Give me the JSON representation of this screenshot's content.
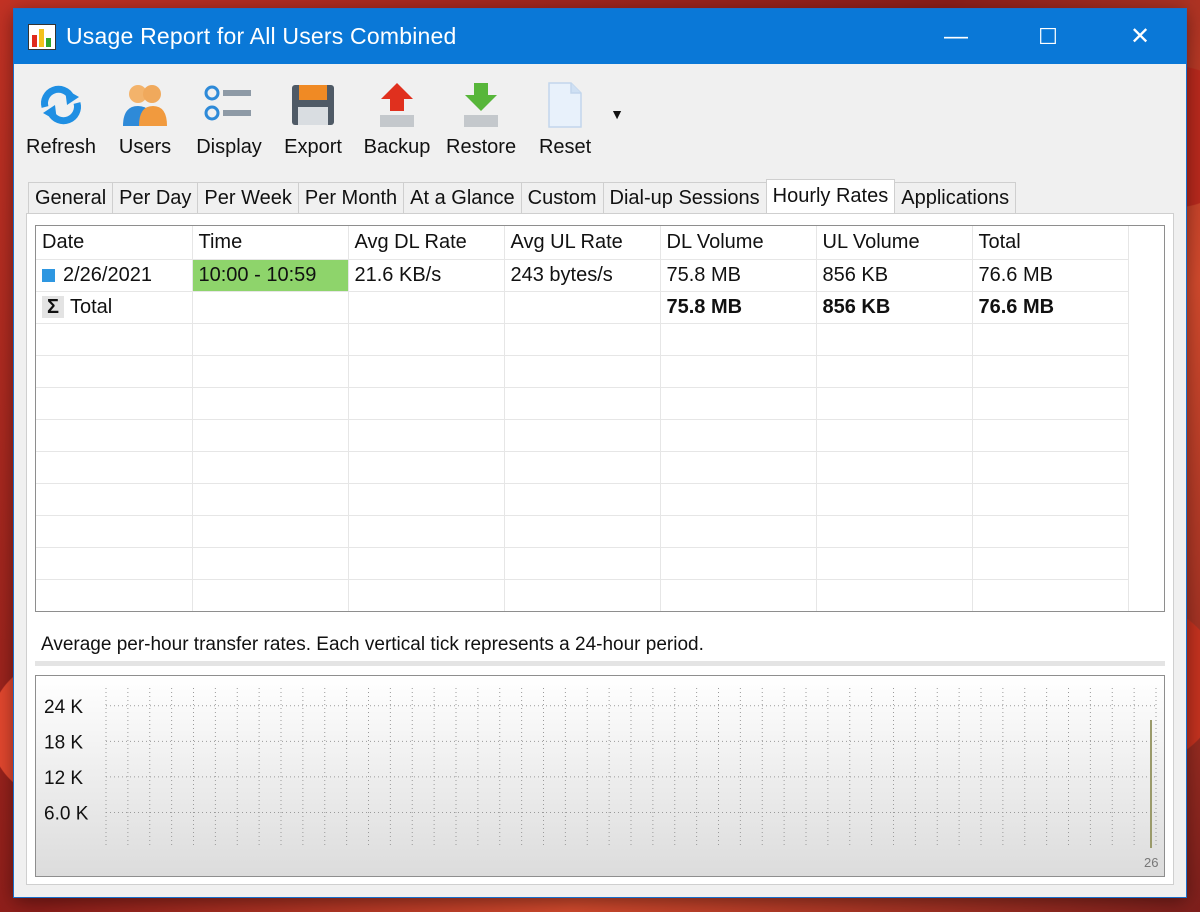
{
  "window": {
    "title": "Usage Report for All Users Combined",
    "controls": [
      "—",
      "☐",
      "✕"
    ]
  },
  "toolbar": [
    {
      "id": "refresh",
      "label": "Refresh",
      "icon": "refresh-icon"
    },
    {
      "id": "users",
      "label": "Users",
      "icon": "users-icon"
    },
    {
      "id": "display",
      "label": "Display",
      "icon": "display-list-icon"
    },
    {
      "id": "export",
      "label": "Export",
      "icon": "floppy-disk-icon"
    },
    {
      "id": "backup",
      "label": "Backup",
      "icon": "upload-arrow-icon"
    },
    {
      "id": "restore",
      "label": "Restore",
      "icon": "download-arrow-icon"
    },
    {
      "id": "reset",
      "label": "Reset",
      "icon": "blank-page-icon"
    }
  ],
  "tabs": [
    "General",
    "Per Day",
    "Per Week",
    "Per Month",
    "At a Glance",
    "Custom",
    "Dial-up Sessions",
    "Hourly Rates",
    "Applications"
  ],
  "active_tab": "Hourly Rates",
  "table": {
    "columns": [
      "Date",
      "Time",
      "Avg DL Rate",
      "Avg UL Rate",
      "DL Volume",
      "UL Volume",
      "Total"
    ],
    "rows": [
      {
        "date": "2/26/2021",
        "time": "10:00 - 10:59",
        "avg_dl": "21.6 KB/s",
        "avg_ul": "243 bytes/s",
        "dl_vol": "75.8 MB",
        "ul_vol": "856 KB",
        "total": "76.6 MB"
      }
    ],
    "total_row": {
      "label": "Total",
      "sigma": "Σ",
      "dl_vol": "75.8 MB",
      "ul_vol": "856 KB",
      "total": "76.6 MB"
    }
  },
  "caption": "Average per-hour transfer rates. Each vertical tick represents a 24-hour period.",
  "chart_data": {
    "type": "bar",
    "y_tick_labels": [
      "24 K",
      "18 K",
      "12 K",
      "6.0 K"
    ],
    "y_ticks": [
      24000,
      18000,
      12000,
      6000
    ],
    "ylim": [
      0,
      27000
    ],
    "x_tick_labels": [
      "26"
    ],
    "x_count": 26,
    "values": [
      0,
      0,
      0,
      0,
      0,
      0,
      0,
      0,
      0,
      0,
      0,
      0,
      0,
      0,
      0,
      0,
      0,
      0,
      0,
      0,
      0,
      0,
      0,
      0,
      0,
      21600
    ],
    "grid": true,
    "bar_color": "#9a9a6a"
  }
}
